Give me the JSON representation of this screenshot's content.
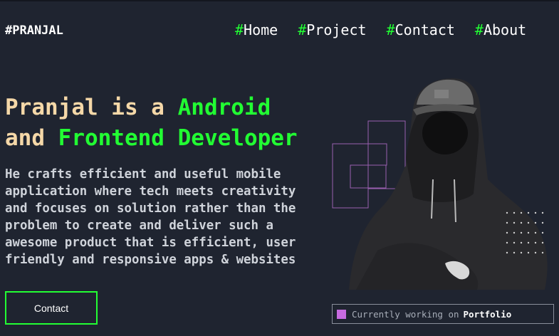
{
  "header": {
    "logo": "#PRANJAL",
    "nav": [
      {
        "hash": "#",
        "label": "Home"
      },
      {
        "hash": "#",
        "label": "Project"
      },
      {
        "hash": "#",
        "label": "Contact"
      },
      {
        "hash": "#",
        "label": "About"
      }
    ]
  },
  "hero": {
    "line1_a": "Pranjal is a ",
    "line1_b": "Android",
    "line2_a": "and ",
    "line2_b": "Frontend Developer",
    "description": "He crafts efficient and useful mobile application where tech meets creativity and focuses on solution rather than the problem to create and deliver such a awesome product that is efficient, user friendly and responsive apps & websites",
    "contact_button": "Contact",
    "status_prefix": "Currently working on",
    "status_project": "Portfolio"
  },
  "colors": {
    "background": "#1f2430",
    "accent_green": "#22ff33",
    "headline_cream": "#f5d8a8",
    "status_square": "#c76be0"
  }
}
